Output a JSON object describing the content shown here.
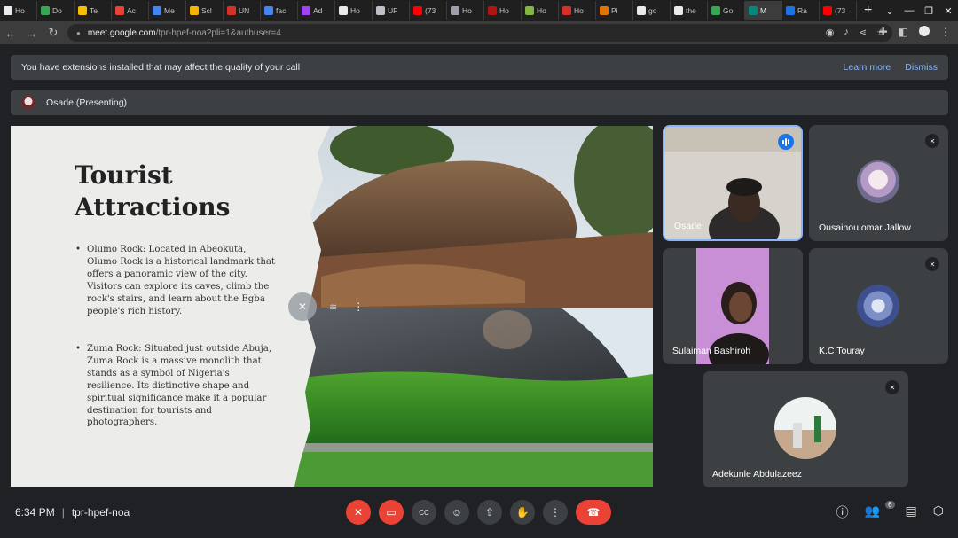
{
  "browser": {
    "tabs": [
      {
        "label": "Ho",
        "color": "#e8eaed"
      },
      {
        "label": "Do",
        "color": "#34a853"
      },
      {
        "label": "Te",
        "color": "#fbbc04"
      },
      {
        "label": "Ac",
        "color": "#ea4335"
      },
      {
        "label": "Me",
        "color": "#4285f4"
      },
      {
        "label": "Scl",
        "color": "#f4b400"
      },
      {
        "label": "UN",
        "color": "#d93025"
      },
      {
        "label": "fac",
        "color": "#4285f4"
      },
      {
        "label": "Ad",
        "color": "#a142f4"
      },
      {
        "label": "Ho",
        "color": "#e8eaed"
      },
      {
        "label": "UF",
        "color": "#bdc1c6"
      },
      {
        "label": "(73",
        "color": "#ff0000"
      },
      {
        "label": "Ho",
        "color": "#9aa0a6"
      },
      {
        "label": "Ho",
        "color": "#b31412"
      },
      {
        "label": "Ho",
        "color": "#84b740"
      },
      {
        "label": "Ho",
        "color": "#d93025"
      },
      {
        "label": "Pi",
        "color": "#e37400"
      },
      {
        "label": "go",
        "color": "#e8eaed"
      },
      {
        "label": "the",
        "color": "#e8eaed"
      },
      {
        "label": "Go",
        "color": "#34a853"
      },
      {
        "label": "M",
        "color": "#00897b",
        "active": true
      },
      {
        "label": "Ra",
        "color": "#1a73e8"
      },
      {
        "label": "(73",
        "color": "#ff0000"
      }
    ],
    "new_tab": "+",
    "url_host": "meet.google.com",
    "url_path": "/tpr-hpef-noa?pli=1&authuser=4"
  },
  "banner": {
    "text": "You have extensions installed that may affect the quality of your call",
    "learn_more": "Learn more",
    "dismiss": "Dismiss"
  },
  "presenter": {
    "label": "Osade (Presenting)"
  },
  "slide": {
    "title_line1": "Tourist",
    "title_line2": "Attractions",
    "bullet1": "Olumo Rock: Located in Abeokuta, Olumo Rock is a historical landmark that offers a panoramic view of the city. Visitors can explore its caves, climb the rock's stairs, and learn about the Egba people's rich history.",
    "bullet2": "Zuma Rock: Situated just outside Abuja, Zuma Rock is a massive monolith that stands as a symbol of Nigeria's resilience. Its distinctive shape and spiritual significance make it a popular destination for tourists and photographers."
  },
  "participants": [
    {
      "name": "Osade",
      "speaking": true
    },
    {
      "name": "Ousainou omar Jallow",
      "muted": true
    },
    {
      "name": "Sulaiman Bashiroh"
    },
    {
      "name": "K.C Touray",
      "muted": true
    },
    {
      "name": "Adekunle Abdulazeez",
      "muted": true
    }
  ],
  "meeting": {
    "time": "6:34 PM",
    "separator": "|",
    "code": "tpr-hpef-noa",
    "people_count": "6"
  }
}
